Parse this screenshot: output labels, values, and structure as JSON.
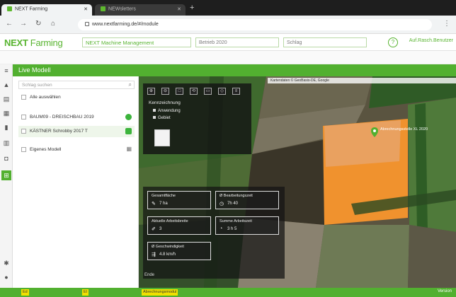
{
  "browser": {
    "tabs": [
      {
        "label": "NEXT Farming",
        "active": true
      },
      {
        "label": "NEWsletters",
        "active": false
      }
    ],
    "url": "www.nextfarming.de/#/module"
  },
  "app": {
    "logo_main": "NEXT",
    "logo_sub": "Farming",
    "module_select": "NEXT Machine Management",
    "filter_1": "Betrieb 2020",
    "filter_2": "Schlag",
    "user_label": "Auf.Rasch.Benutzer"
  },
  "titlebar": {
    "title": "Live Modell"
  },
  "panel": {
    "search_placeholder": "Schlag suchen",
    "rows": [
      {
        "label": "Alle auswählen"
      },
      {
        "label": "BAUM09 - DREISCHBAU 2019"
      },
      {
        "label": "KÄSTNER Schrobby 2017 T"
      },
      {
        "label": "Eigenes Modell"
      }
    ]
  },
  "map": {
    "scalebar_text": "Kartendaten © GeoBasis-DE, Google",
    "layer_heading": "Kennzeichnung",
    "layer_options": [
      "Anwendung",
      "Gebiet"
    ],
    "toolbar_buttons": [
      "⊕",
      "⊖",
      "□",
      "⟲",
      "▭",
      "◇",
      "≡"
    ],
    "pin_label": "Abrechnungsstelle XL 2020",
    "legend_text": "Ende",
    "stats": [
      {
        "key": "Gesamtfläche",
        "value": "7 ha",
        "icon": "area-icon"
      },
      {
        "key": "Ø Bearbeitungszeit",
        "value": "7h 40",
        "icon": "clock-icon"
      },
      {
        "key": "Aktuelle Arbeitsbreite",
        "value": "3",
        "icon": "pen-icon"
      },
      {
        "key": "Summe Arbeitszeit",
        "value": "3 h 5",
        "icon": "timer-icon"
      },
      {
        "key": "Ø Geschwindigkeit",
        "value": "4.8 km/h",
        "icon": "speed-icon"
      }
    ]
  },
  "bottom": {
    "chips": [
      "Ed",
      "El",
      "Abrechnungsmodul"
    ],
    "right_text": "Version"
  },
  "colors": {
    "brand": "#52b030",
    "field_highlight": "#f0922e"
  }
}
